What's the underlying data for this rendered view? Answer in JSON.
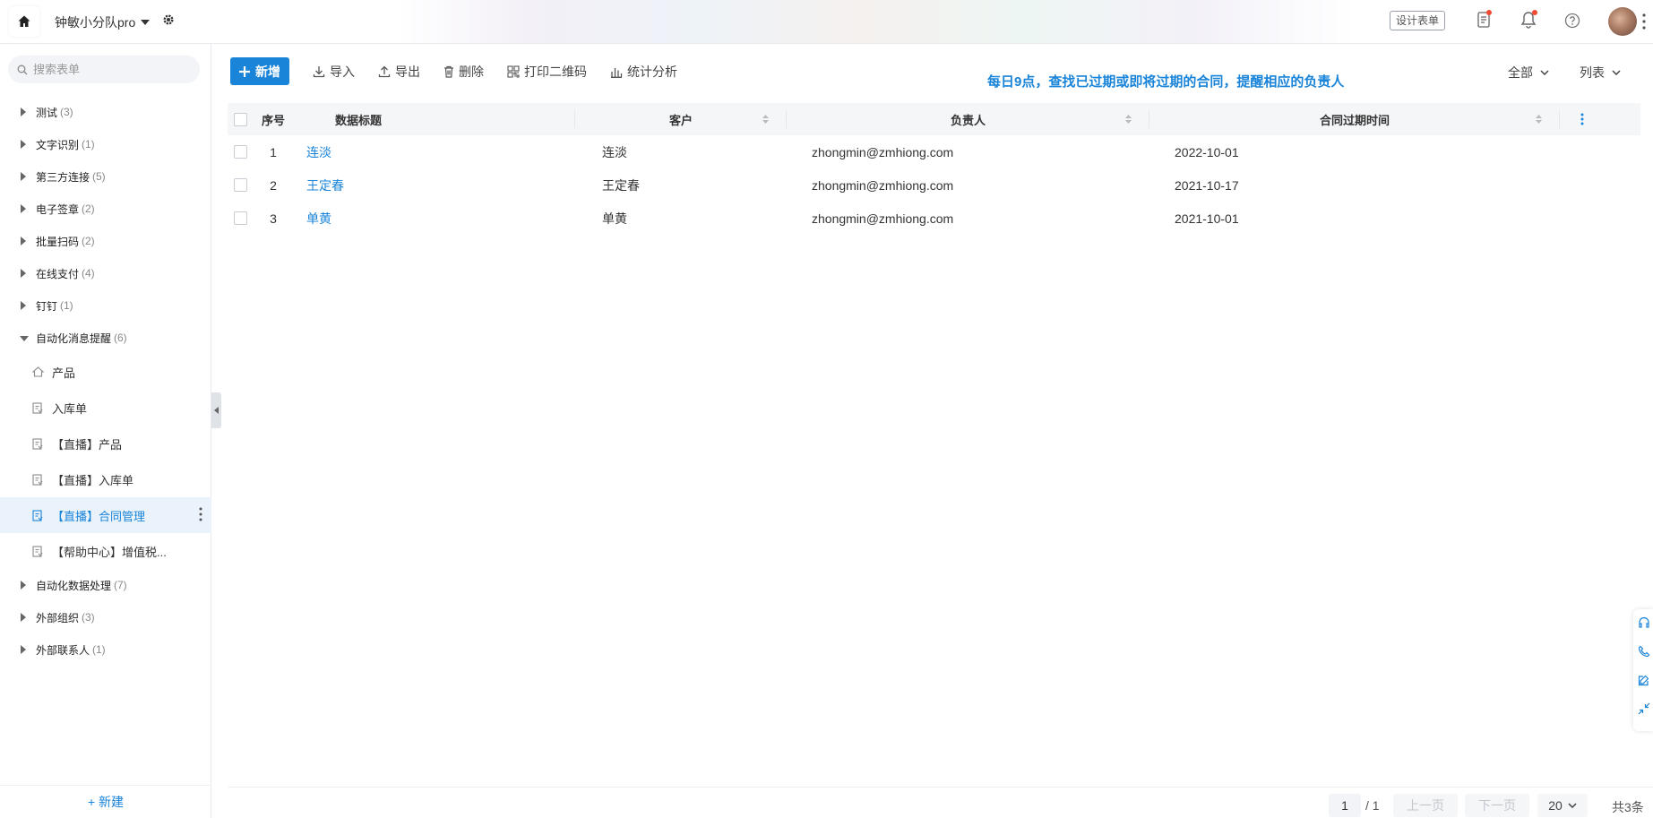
{
  "header": {
    "team_name": "钟敏小分队pro",
    "design_button": "设计表单",
    "icons": [
      "home-icon",
      "caret-down-icon",
      "gear-icon",
      "task-icon",
      "bell-icon",
      "help-icon",
      "avatar"
    ]
  },
  "sidebar": {
    "search_placeholder": "搜索表单",
    "groups_before": [
      {
        "label": "测试",
        "count": "(3)"
      },
      {
        "label": "文字识别",
        "count": "(1)"
      },
      {
        "label": "第三方连接",
        "count": "(5)"
      },
      {
        "label": "电子签章",
        "count": "(2)"
      },
      {
        "label": "批量扫码",
        "count": "(2)"
      },
      {
        "label": "在线支付",
        "count": "(4)"
      },
      {
        "label": "钉钉",
        "count": "(1)"
      }
    ],
    "expanded_group": {
      "label": "自动化消息提醒",
      "count": "(6)"
    },
    "leaves": [
      {
        "label": "产品"
      },
      {
        "label": "入库单"
      },
      {
        "label": "【直播】产品"
      },
      {
        "label": "【直播】入库单"
      },
      {
        "label": "【直播】合同管理"
      },
      {
        "label": "【帮助中心】增值税..."
      }
    ],
    "groups_after": [
      {
        "label": "自动化数据处理",
        "count": "(7)"
      },
      {
        "label": "外部组织",
        "count": "(3)"
      },
      {
        "label": "外部联系人",
        "count": "(1)"
      }
    ],
    "new_button": "+ 新建"
  },
  "toolbar": {
    "add": "新增",
    "import": "导入",
    "export": "导出",
    "delete": "删除",
    "print_qr": "打印二维码",
    "stats": "统计分析",
    "notice": "每日9点，查找已过期或即将过期的合同，提醒相应的负责人",
    "filter_all": "全部",
    "view_list": "列表"
  },
  "table": {
    "columns": [
      "序号",
      "数据标题",
      "客户",
      "负责人",
      "合同过期时间"
    ],
    "rows": [
      {
        "no": "1",
        "title": "连淡",
        "customer": "连淡",
        "owner": "zhongmin@zmhiong.com",
        "expire": "2022-10-01"
      },
      {
        "no": "2",
        "title": "王定春",
        "customer": "王定春",
        "owner": "zhongmin@zmhiong.com",
        "expire": "2021-10-17"
      },
      {
        "no": "3",
        "title": "单黄",
        "customer": "单黄",
        "owner": "zhongmin@zmhiong.com",
        "expire": "2021-10-01"
      }
    ]
  },
  "pager": {
    "current": "1",
    "total_pages": "/ 1",
    "prev": "上一页",
    "next": "下一页",
    "page_size": "20",
    "count": "共3条"
  },
  "colors": {
    "accent": "#1a84d9",
    "active_bg": "#eaf3fc",
    "badge": "#f04a32"
  }
}
